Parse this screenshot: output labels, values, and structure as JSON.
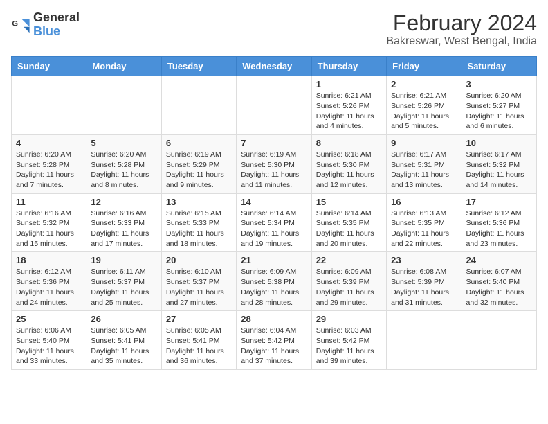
{
  "logo": {
    "general": "General",
    "blue": "Blue"
  },
  "header": {
    "title": "February 2024",
    "subtitle": "Bakreswar, West Bengal, India"
  },
  "weekdays": [
    "Sunday",
    "Monday",
    "Tuesday",
    "Wednesday",
    "Thursday",
    "Friday",
    "Saturday"
  ],
  "weeks": [
    [
      {
        "day": "",
        "info": ""
      },
      {
        "day": "",
        "info": ""
      },
      {
        "day": "",
        "info": ""
      },
      {
        "day": "",
        "info": ""
      },
      {
        "day": "1",
        "info": "Sunrise: 6:21 AM\nSunset: 5:26 PM\nDaylight: 11 hours and 4 minutes."
      },
      {
        "day": "2",
        "info": "Sunrise: 6:21 AM\nSunset: 5:26 PM\nDaylight: 11 hours and 5 minutes."
      },
      {
        "day": "3",
        "info": "Sunrise: 6:20 AM\nSunset: 5:27 PM\nDaylight: 11 hours and 6 minutes."
      }
    ],
    [
      {
        "day": "4",
        "info": "Sunrise: 6:20 AM\nSunset: 5:28 PM\nDaylight: 11 hours and 7 minutes."
      },
      {
        "day": "5",
        "info": "Sunrise: 6:20 AM\nSunset: 5:28 PM\nDaylight: 11 hours and 8 minutes."
      },
      {
        "day": "6",
        "info": "Sunrise: 6:19 AM\nSunset: 5:29 PM\nDaylight: 11 hours and 9 minutes."
      },
      {
        "day": "7",
        "info": "Sunrise: 6:19 AM\nSunset: 5:30 PM\nDaylight: 11 hours and 11 minutes."
      },
      {
        "day": "8",
        "info": "Sunrise: 6:18 AM\nSunset: 5:30 PM\nDaylight: 11 hours and 12 minutes."
      },
      {
        "day": "9",
        "info": "Sunrise: 6:17 AM\nSunset: 5:31 PM\nDaylight: 11 hours and 13 minutes."
      },
      {
        "day": "10",
        "info": "Sunrise: 6:17 AM\nSunset: 5:32 PM\nDaylight: 11 hours and 14 minutes."
      }
    ],
    [
      {
        "day": "11",
        "info": "Sunrise: 6:16 AM\nSunset: 5:32 PM\nDaylight: 11 hours and 15 minutes."
      },
      {
        "day": "12",
        "info": "Sunrise: 6:16 AM\nSunset: 5:33 PM\nDaylight: 11 hours and 17 minutes."
      },
      {
        "day": "13",
        "info": "Sunrise: 6:15 AM\nSunset: 5:33 PM\nDaylight: 11 hours and 18 minutes."
      },
      {
        "day": "14",
        "info": "Sunrise: 6:14 AM\nSunset: 5:34 PM\nDaylight: 11 hours and 19 minutes."
      },
      {
        "day": "15",
        "info": "Sunrise: 6:14 AM\nSunset: 5:35 PM\nDaylight: 11 hours and 20 minutes."
      },
      {
        "day": "16",
        "info": "Sunrise: 6:13 AM\nSunset: 5:35 PM\nDaylight: 11 hours and 22 minutes."
      },
      {
        "day": "17",
        "info": "Sunrise: 6:12 AM\nSunset: 5:36 PM\nDaylight: 11 hours and 23 minutes."
      }
    ],
    [
      {
        "day": "18",
        "info": "Sunrise: 6:12 AM\nSunset: 5:36 PM\nDaylight: 11 hours and 24 minutes."
      },
      {
        "day": "19",
        "info": "Sunrise: 6:11 AM\nSunset: 5:37 PM\nDaylight: 11 hours and 25 minutes."
      },
      {
        "day": "20",
        "info": "Sunrise: 6:10 AM\nSunset: 5:37 PM\nDaylight: 11 hours and 27 minutes."
      },
      {
        "day": "21",
        "info": "Sunrise: 6:09 AM\nSunset: 5:38 PM\nDaylight: 11 hours and 28 minutes."
      },
      {
        "day": "22",
        "info": "Sunrise: 6:09 AM\nSunset: 5:39 PM\nDaylight: 11 hours and 29 minutes."
      },
      {
        "day": "23",
        "info": "Sunrise: 6:08 AM\nSunset: 5:39 PM\nDaylight: 11 hours and 31 minutes."
      },
      {
        "day": "24",
        "info": "Sunrise: 6:07 AM\nSunset: 5:40 PM\nDaylight: 11 hours and 32 minutes."
      }
    ],
    [
      {
        "day": "25",
        "info": "Sunrise: 6:06 AM\nSunset: 5:40 PM\nDaylight: 11 hours and 33 minutes."
      },
      {
        "day": "26",
        "info": "Sunrise: 6:05 AM\nSunset: 5:41 PM\nDaylight: 11 hours and 35 minutes."
      },
      {
        "day": "27",
        "info": "Sunrise: 6:05 AM\nSunset: 5:41 PM\nDaylight: 11 hours and 36 minutes."
      },
      {
        "day": "28",
        "info": "Sunrise: 6:04 AM\nSunset: 5:42 PM\nDaylight: 11 hours and 37 minutes."
      },
      {
        "day": "29",
        "info": "Sunrise: 6:03 AM\nSunset: 5:42 PM\nDaylight: 11 hours and 39 minutes."
      },
      {
        "day": "",
        "info": ""
      },
      {
        "day": "",
        "info": ""
      }
    ]
  ]
}
